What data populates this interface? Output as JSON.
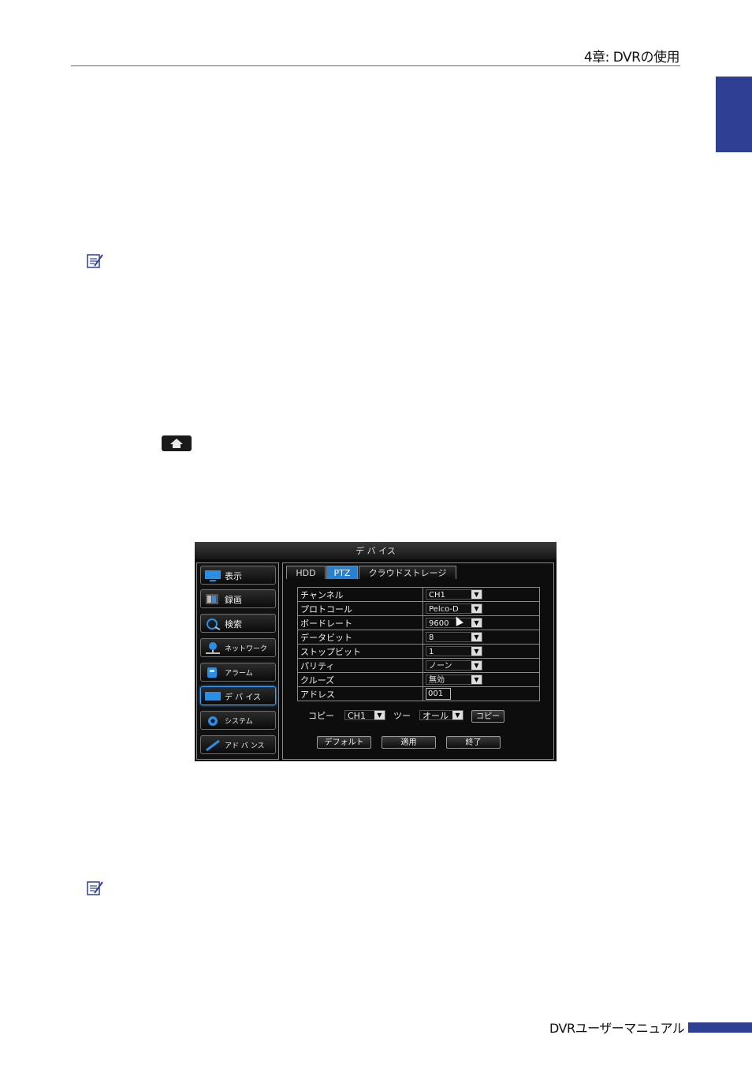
{
  "header": {
    "title": "4章: DVRの使用"
  },
  "footer": {
    "title": "DVRユーザーマニュアル"
  },
  "dvr": {
    "window_title": "デ バ イス",
    "sidebar": [
      {
        "label": "表示",
        "icon": "monitor-icon"
      },
      {
        "label": "録画",
        "icon": "film-icon"
      },
      {
        "label": "検索",
        "icon": "magnifier-icon"
      },
      {
        "label": "ネットワーク",
        "icon": "network-icon"
      },
      {
        "label": "アラーム",
        "icon": "alarm-icon"
      },
      {
        "label": "デ バ イス",
        "icon": "device-icon",
        "active": true
      },
      {
        "label": "システム",
        "icon": "gear-icon"
      },
      {
        "label": "アド バ ンス",
        "icon": "wrench-icon"
      }
    ],
    "tabs": [
      "HDD",
      "PTZ",
      "クラウドストレージ"
    ],
    "active_tab": "PTZ",
    "rows": [
      {
        "label": "チャンネル",
        "value": "CH1"
      },
      {
        "label": "プロトコール",
        "value": "Pelco-D"
      },
      {
        "label": "ボードレート",
        "value": "9600"
      },
      {
        "label": "データビット",
        "value": "8"
      },
      {
        "label": "ストップビット",
        "value": "1"
      },
      {
        "label": "パリティ",
        "value": "ノーン"
      },
      {
        "label": "クルーズ",
        "value": "無効"
      },
      {
        "label": "アドレス",
        "value": "001"
      }
    ],
    "copy": {
      "label": "コピー",
      "from_value": "CH1",
      "to_label": "ツー",
      "to_value": "オール",
      "button": "コピー"
    },
    "buttons": {
      "default": "デフォルト",
      "apply": "適用",
      "exit": "終了"
    }
  },
  "colors": {
    "brand_blue": "#2e3f94",
    "accent_active": "#2a7fcf"
  }
}
